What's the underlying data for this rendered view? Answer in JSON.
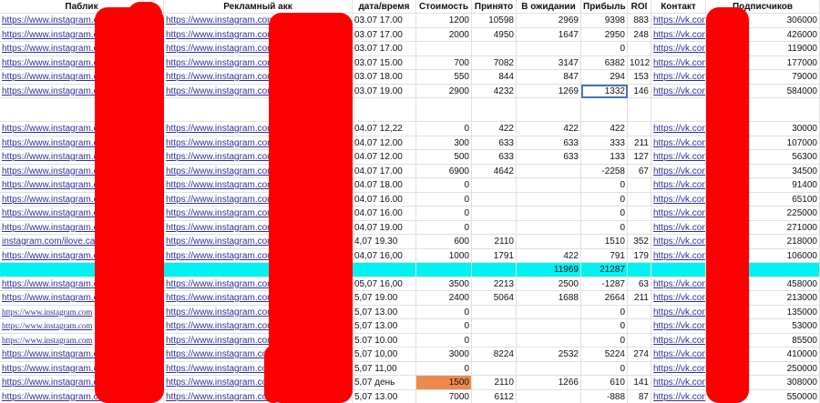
{
  "columns": [
    "Паблик",
    "Рекламный акк",
    "дата/время",
    "Стоимость",
    "Принято",
    "В ожидании",
    "Прибыль",
    "ROI",
    "Контакт",
    "Подписчиков"
  ],
  "rows": [
    {
      "pub": "https://www.instagram.com",
      "acc": "https://www.instagram.com",
      "dt": "03.07 17.00",
      "cost": "1200",
      "acc2": "10598",
      "wait": "2969",
      "profit": "9398",
      "roi": "883",
      "contact": "https://vk.com",
      "subs": "306000"
    },
    {
      "pub": "https://www.instagram.com",
      "acc": "https://www.instagram.com",
      "dt": "03.07 17.00",
      "cost": "2000",
      "acc2": "4950",
      "wait": "1647",
      "profit": "2950",
      "roi": "248",
      "contact": "https://vk.com",
      "subs": "426000"
    },
    {
      "pub": "https://www.instagram.com",
      "acc": "https://www.instagram.com",
      "dt": "03.07 17.00",
      "cost": "",
      "acc2": "",
      "wait": "",
      "profit": "0",
      "roi": "",
      "contact": "https://vk.com",
      "subs": "119000"
    },
    {
      "pub": "https://www.instagram.com",
      "acc": "https://www.instagram.com",
      "dt": "03.07 15.00",
      "cost": "700",
      "acc2": "7082",
      "wait": "3147",
      "profit": "6382",
      "roi": "1012",
      "contact": "https://vk.com",
      "subs": "177000"
    },
    {
      "pub": "https://www.instagram.com",
      "acc": "https://www.instagram.com",
      "dt": "03.07 18.00",
      "cost": "550",
      "acc2": "844",
      "wait": "847",
      "profit": "294",
      "roi": "153",
      "contact": "https://vk.com",
      "subs": "79000"
    },
    {
      "pub": "https://www.instagram.com",
      "acc": "https://www.instagram.com",
      "dt": "03.07 19.00",
      "cost": "2900",
      "acc2": "4232",
      "wait": "1269",
      "profit": "1332",
      "roi": "146",
      "contact": "https://vk.com",
      "subs": "584000"
    },
    {
      "pub": "",
      "acc": "",
      "dt": "",
      "cost": "",
      "acc2": "",
      "wait": "",
      "profit": "",
      "roi": "",
      "contact": "",
      "subs": ""
    },
    {
      "pub": "https://www.instagram.com",
      "acc": "https://www.instagram.com",
      "dt": "04.07 12,22",
      "cost": "0",
      "acc2": "422",
      "wait": "422",
      "profit": "422",
      "roi": "",
      "contact": "https://vk.com/",
      "subs": "30000"
    },
    {
      "pub": "https://www.instagram.com",
      "acc": "https://www.instagram.com",
      "dt": "04.07 12.00",
      "cost": "300",
      "acc2": "633",
      "wait": "633",
      "profit": "333",
      "roi": "211",
      "contact": "https://vk.com",
      "subs": "107000"
    },
    {
      "pub": "https://www.instagram.com",
      "acc": "https://www.instagram.com",
      "dt": "04.07 12.00",
      "cost": "500",
      "acc2": "633",
      "wait": "633",
      "profit": "133",
      "roi": "127",
      "contact": "https://vk.com",
      "subs": "56300"
    },
    {
      "pub": "https://www.instagram.com",
      "acc": "https://www.instagram.com",
      "dt": "04.07 17.00",
      "cost": "6900",
      "acc2": "4642",
      "wait": "",
      "profit": "-2258",
      "roi": "67",
      "contact": "https://vk.com",
      "subs": "34500"
    },
    {
      "pub": "https://www.instagram.com",
      "acc": "https://www.instagram.com",
      "dt": "04.07 18.00",
      "cost": "0",
      "acc2": "",
      "wait": "",
      "profit": "0",
      "roi": "",
      "contact": "https://vk.com",
      "subs": "91400"
    },
    {
      "pub": "https://www.instagram.com",
      "acc": "https://www.instagram.com",
      "dt": "04.07 16.00",
      "cost": "0",
      "acc2": "",
      "wait": "",
      "profit": "0",
      "roi": "",
      "contact": "https://vk.com",
      "subs": "65100"
    },
    {
      "pub": "https://www.instagram.com",
      "acc": "https://www.instagram.com",
      "dt": "04.07 16.00",
      "cost": "0",
      "acc2": "",
      "wait": "",
      "profit": "0",
      "roi": "",
      "contact": "https://vk.com",
      "subs": "225000"
    },
    {
      "pub": "https://www.instagram.com",
      "acc": "https://www.instagram.com",
      "dt": "04.07 19.00",
      "cost": "0",
      "acc2": "",
      "wait": "",
      "profit": "0",
      "roi": "",
      "contact": "https://vk.com",
      "subs": "271000"
    },
    {
      "pub": "instagram.com/ilove.car",
      "acc": "https://www.instagram.com",
      "dt": "4,07 19.30",
      "cost": "600",
      "acc2": "2110",
      "wait": "",
      "profit": "1510",
      "roi": "352",
      "contact": "https://vk.com",
      "subs": "218000"
    },
    {
      "pub": "https://www.instagram.com",
      "acc": "https://www.instagram.com",
      "dt": "04,07 16,00",
      "cost": "1000",
      "acc2": "1791",
      "wait": "422",
      "profit": "791",
      "roi": "179",
      "contact": "https://vk.com",
      "subs": "106000"
    },
    {
      "pub": "",
      "acc": "",
      "dt": "",
      "cost": "",
      "acc2": "",
      "wait": "11969",
      "profit": "21287",
      "roi": "",
      "contact": "",
      "subs": ""
    },
    {
      "pub": "https://www.instagram.com",
      "acc": "https://www.instagram.com",
      "dt": "05,07 16,00",
      "cost": "3500",
      "acc2": "2213",
      "wait": "2500",
      "profit": "-1287",
      "roi": "63",
      "contact": "https://vk.com",
      "subs": "458000"
    },
    {
      "pub": "https://www.instagram.com",
      "acc": "https://www.instagram.com",
      "dt": "5,07 19.00",
      "cost": "2400",
      "acc2": "5064",
      "wait": "1688",
      "profit": "2664",
      "roi": "211",
      "contact": "https://vk.com",
      "subs": "213000"
    },
    {
      "pub": "https://www.instagram.com",
      "acc": "https://www.instagram.com",
      "dt": "5,07 13.00",
      "cost": "0",
      "acc2": "",
      "wait": "",
      "profit": "0",
      "roi": "",
      "contact": "https://vk.com",
      "subs": "135000"
    },
    {
      "pub": "https://www.instagram.com",
      "acc": "https://www.instagram.com",
      "dt": "5,07 13.00",
      "cost": "0",
      "acc2": "",
      "wait": "",
      "profit": "0",
      "roi": "",
      "contact": "https://vk.com",
      "subs": "53000"
    },
    {
      "pub": "https://www.instagram.com",
      "acc": "https://www.instagram.com",
      "dt": "5.07 10.00",
      "cost": "0",
      "acc2": "",
      "wait": "",
      "profit": "0",
      "roi": "",
      "contact": "https://vk.com",
      "subs": "85500"
    },
    {
      "pub": "https://www.instagram.com",
      "acc": "https://www.instagram.com",
      "dt": "5,07 10,00",
      "cost": "3000",
      "acc2": "8224",
      "wait": "2532",
      "profit": "5224",
      "roi": "274",
      "contact": "https://vk.com",
      "subs": "410000"
    },
    {
      "pub": "https://www.instagram.com",
      "acc": "https://www.instagram.com",
      "dt": "5,07 11,00",
      "cost": "0",
      "acc2": "",
      "wait": "",
      "profit": "0",
      "roi": "",
      "contact": "https://vk.com",
      "subs": "250000"
    },
    {
      "pub": "https://www.instagram.com",
      "acc": "https://www.instagram.com",
      "dt": "5,07 день",
      "cost": "1500",
      "acc2": "2110",
      "wait": "1266",
      "profit": "610",
      "roi": "141",
      "contact": "https://vk.com",
      "subs": "308000"
    },
    {
      "pub": "https://www.instagram.com",
      "acc": "https://www.instagram.com",
      "dt": "5,07 13.00",
      "cost": "7000",
      "acc2": "6112",
      "wait": "",
      "profit": "-888",
      "roi": "87",
      "contact": "https://vk.com",
      "subs": "550000"
    }
  ],
  "colors": {
    "highlight_row": "#00f2f2",
    "cost_highlight": "#ee8a4e",
    "redaction": "#fb0000",
    "link": "#30309a"
  }
}
